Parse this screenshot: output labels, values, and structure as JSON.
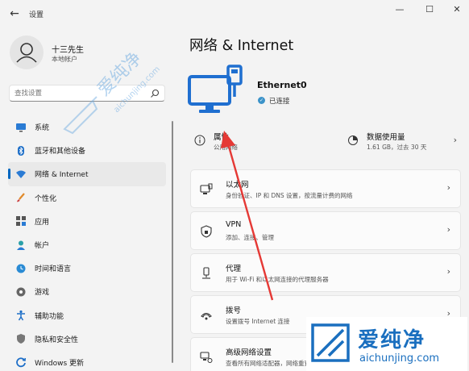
{
  "window": {
    "app_title": "设置",
    "back_glyph": "←",
    "minimize_glyph": "—",
    "maximize_glyph": "☐",
    "close_glyph": "✕"
  },
  "profile": {
    "name": "十三先生",
    "account_type": "本地帐户"
  },
  "search": {
    "placeholder": "查找设置"
  },
  "sidebar": {
    "items": [
      {
        "label": "系统",
        "icon": "monitor-icon",
        "active": false
      },
      {
        "label": "蓝牙和其他设备",
        "icon": "bluetooth-icon",
        "active": false
      },
      {
        "label": "网络 & Internet",
        "icon": "wifi-icon",
        "active": true
      },
      {
        "label": "个性化",
        "icon": "brush-icon",
        "active": false
      },
      {
        "label": "应用",
        "icon": "apps-icon",
        "active": false
      },
      {
        "label": "帐户",
        "icon": "person-icon",
        "active": false
      },
      {
        "label": "时间和语言",
        "icon": "globe-clock-icon",
        "active": false
      },
      {
        "label": "游戏",
        "icon": "gamepad-icon",
        "active": false
      },
      {
        "label": "辅助功能",
        "icon": "accessibility-icon",
        "active": false
      },
      {
        "label": "隐私和安全性",
        "icon": "shield-icon",
        "active": false
      },
      {
        "label": "Windows 更新",
        "icon": "update-icon",
        "active": false
      }
    ]
  },
  "main": {
    "title": "网络 & Internet",
    "adapter": {
      "name": "Ethernet0",
      "status": "已连接"
    },
    "properties": {
      "title": "属性",
      "subtitle": "公用网络"
    },
    "data_usage": {
      "title": "数据使用量",
      "subtitle": "1.61 GB，过去 30 天"
    },
    "cards": [
      {
        "title": "以太网",
        "subtitle": "身份验证、IP 和 DNS 设置，按流量计费的网络",
        "icon": "ethernet-port-icon"
      },
      {
        "title": "VPN",
        "subtitle": "添加、连接、管理",
        "icon": "vpn-shield-icon"
      },
      {
        "title": "代理",
        "subtitle": "用于 Wi-Fi 和以太网连接的代理服务器",
        "icon": "proxy-server-icon"
      },
      {
        "title": "拨号",
        "subtitle": "设置拨号 Internet 连接",
        "icon": "dialup-phone-icon"
      },
      {
        "title": "高级网络设置",
        "subtitle": "查看所有网络适配器，网络重置",
        "icon": "advanced-network-icon"
      }
    ]
  },
  "watermark": {
    "brand_text": "爱纯净",
    "url_text": "aichunjing.com"
  },
  "colors": {
    "accent": "#0067c0",
    "annotation_arrow": "#e53935"
  }
}
